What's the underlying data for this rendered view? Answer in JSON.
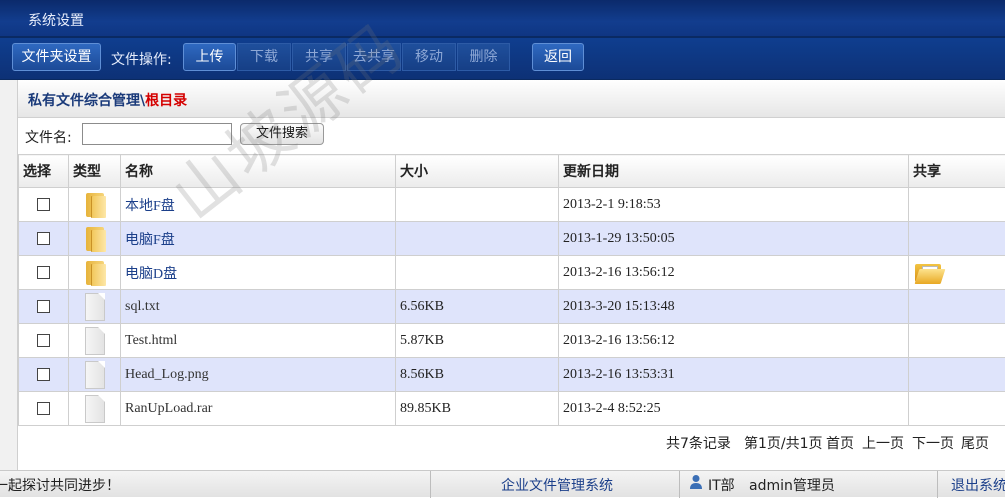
{
  "titlebar": {
    "title": "系统设置"
  },
  "toolbar": {
    "folder_settings": "文件夹设置",
    "file_ops_label": "文件操作:",
    "upload": "上传",
    "download": "下载",
    "share": "共享",
    "unshare": "去共享",
    "move": "移动",
    "delete": "删除",
    "back": "返回"
  },
  "breadcrumb": {
    "section": "私有文件综合管理\\",
    "root": "根目录"
  },
  "search": {
    "label": "文件名:",
    "value": "",
    "button": "文件搜索"
  },
  "table": {
    "headers": {
      "select": "选择",
      "type": "类型",
      "name": "名称",
      "size": "大小",
      "updated": "更新日期",
      "share": "共享"
    },
    "rows": [
      {
        "type": "folder",
        "name": "本地F盘",
        "size": "",
        "date": "2013-2-1 9:18:53",
        "shared": false
      },
      {
        "type": "folder",
        "name": "电脑F盘",
        "size": "",
        "date": "2013-1-29 13:50:05",
        "shared": false
      },
      {
        "type": "folder",
        "name": "电脑D盘",
        "size": "",
        "date": "2013-2-16 13:56:12",
        "shared": true
      },
      {
        "type": "file",
        "name": "sql.txt",
        "size": "6.56KB",
        "date": "2013-3-20 15:13:48",
        "shared": false
      },
      {
        "type": "file",
        "name": "Test.html",
        "size": "5.87KB",
        "date": "2013-2-16 13:56:12",
        "shared": false
      },
      {
        "type": "file",
        "name": "Head_Log.png",
        "size": "8.56KB",
        "date": "2013-2-16 13:53:31",
        "shared": false
      },
      {
        "type": "file",
        "name": "RanUpLoad.rar",
        "size": "89.85KB",
        "date": "2013-2-4 8:52:25",
        "shared": false
      }
    ]
  },
  "pager": {
    "total": "共7条记录",
    "pages": "第1页/共1页",
    "first": "首页",
    "prev": "上一页",
    "next": "下一页",
    "last": "尾页"
  },
  "status": {
    "marquee": "一起探讨共同进步！",
    "system_name": "企业文件管理系统",
    "department": "IT部",
    "user": "admin管理员",
    "logout": "退出系统"
  },
  "watermark": "山坡源码",
  "colors": {
    "title_bg": "#123d8e",
    "alt_row": "#dfe4fb",
    "root_red": "#d40000",
    "link_blue": "#1b3f8a"
  }
}
